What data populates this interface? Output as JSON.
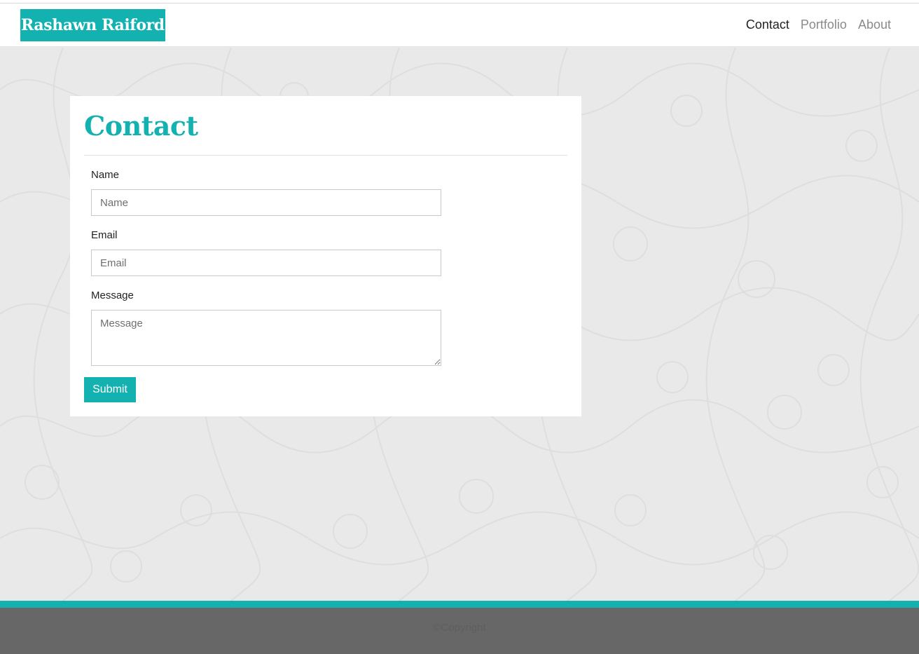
{
  "header": {
    "brand": "Rashawn Raiford",
    "nav": [
      {
        "label": "Contact",
        "active": true
      },
      {
        "label": "Portfolio",
        "active": false
      },
      {
        "label": "About",
        "active": false
      }
    ]
  },
  "contact_form": {
    "title": "Contact",
    "name_label": "Name",
    "name_placeholder": "Name",
    "email_label": "Email",
    "email_placeholder": "Email",
    "message_label": "Message",
    "message_placeholder": "Message",
    "submit_label": "Submit"
  },
  "footer": {
    "copyright": "©Copyright"
  },
  "colors": {
    "accent": "#14b1b1",
    "background": "#e9e9e9",
    "footer": "#676767"
  }
}
